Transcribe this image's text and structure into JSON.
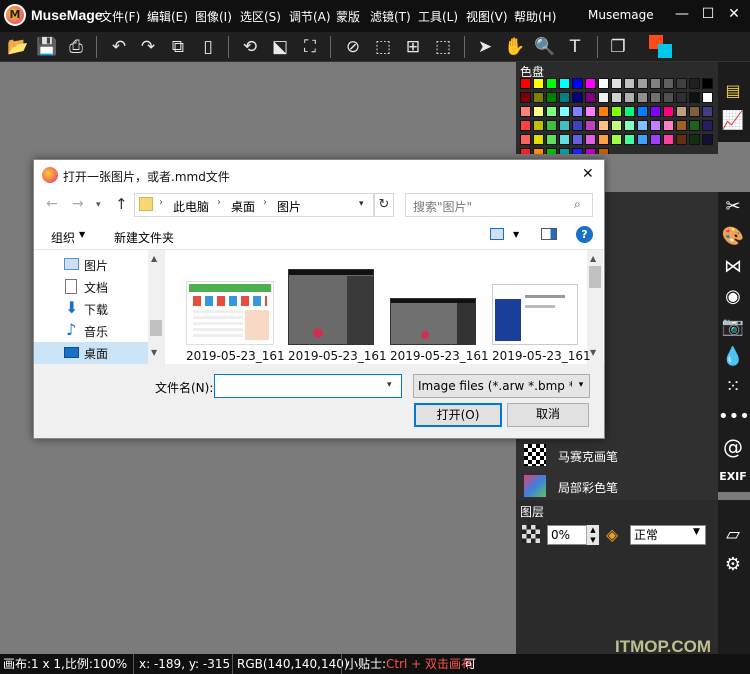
{
  "app": {
    "name": "MuseMage",
    "title": "Musemage"
  },
  "menu": [
    "文件(F)",
    "编辑(E)",
    "图像(I)",
    "选区(S)",
    "调节(A)",
    "蒙版",
    "滤镜(T)",
    "工具(L)",
    "视图(V)",
    "帮助(H)"
  ],
  "panels": {
    "palette_title": "色盘",
    "layers_title": "图层",
    "opacity_value": "0%",
    "blend_mode": "正常",
    "brushes": [
      "马赛克画笔",
      "局部彩色笔"
    ]
  },
  "palette_colors": [
    "#ff0000",
    "#ffff00",
    "#00ff00",
    "#00ffff",
    "#0000ff",
    "#ff00ff",
    "#ffffff",
    "#e0e0e0",
    "#c0c0c0",
    "#a0a0a0",
    "#808080",
    "#606060",
    "#404040",
    "#202020",
    "#000000",
    "#800000",
    "#808000",
    "#008000",
    "#008080",
    "#000080",
    "#800080",
    "#f0f0f0",
    "#d0d0d0",
    "#b0b0b0",
    "#909090",
    "#707070",
    "#505050",
    "#303030",
    "#101010",
    "#ffffff",
    "#ff8080",
    "#ffff80",
    "#80ff80",
    "#80ffff",
    "#8080ff",
    "#ff80ff",
    "#ff8000",
    "#80ff00",
    "#00ff80",
    "#0080ff",
    "#8000ff",
    "#ff0080",
    "#c0a080",
    "#806040",
    "#404080",
    "#ff4040",
    "#c0c000",
    "#40c040",
    "#40c0c0",
    "#4040c0",
    "#c040c0",
    "#ffc080",
    "#c0ff80",
    "#80ffc0",
    "#80c0ff",
    "#c080ff",
    "#ff80c0",
    "#a06020",
    "#206020",
    "#202060",
    "#ff6060",
    "#e0e000",
    "#60e060",
    "#60e0e0",
    "#6060e0",
    "#e060e0",
    "#ffa040",
    "#a0ff40",
    "#40ffa0",
    "#40a0ff",
    "#a040ff",
    "#ff40a0",
    "#603010",
    "#103010",
    "#101030",
    "#ff2020",
    "#ff9000",
    "#00c000",
    "#00a0a0",
    "#2020ff",
    "#c000c0",
    "#c06000"
  ],
  "statusbar": {
    "canvas": "画布:1 x 1,比例:100%",
    "coords": "x: -189, y: -315",
    "rgb": "RGB(140,140,140)",
    "tip_label": "小贴士:",
    "tip_keys": "Ctrl + 双击画布",
    "tip_rest": "可"
  },
  "dialog": {
    "title": "打开一张图片，或者.mmd文件",
    "breadcrumb": [
      "此电脑",
      "桌面",
      "图片"
    ],
    "search_placeholder": "搜索\"图片\"",
    "organize": "组织",
    "new_folder": "新建文件夹",
    "nav_items": [
      "图片",
      "文档",
      "下载",
      "音乐",
      "桌面"
    ],
    "files": [
      "2019-05-23_161",
      "2019-05-23_161",
      "2019-05-23_161",
      "2019-05-23_161"
    ],
    "filename_label": "文件名(N):",
    "filename_value": "",
    "filetype": "Image files (*.arw *.bmp *.cr",
    "open_button": "打开(O)",
    "cancel_button": "取消"
  },
  "watermark": "ITMOP.COM"
}
